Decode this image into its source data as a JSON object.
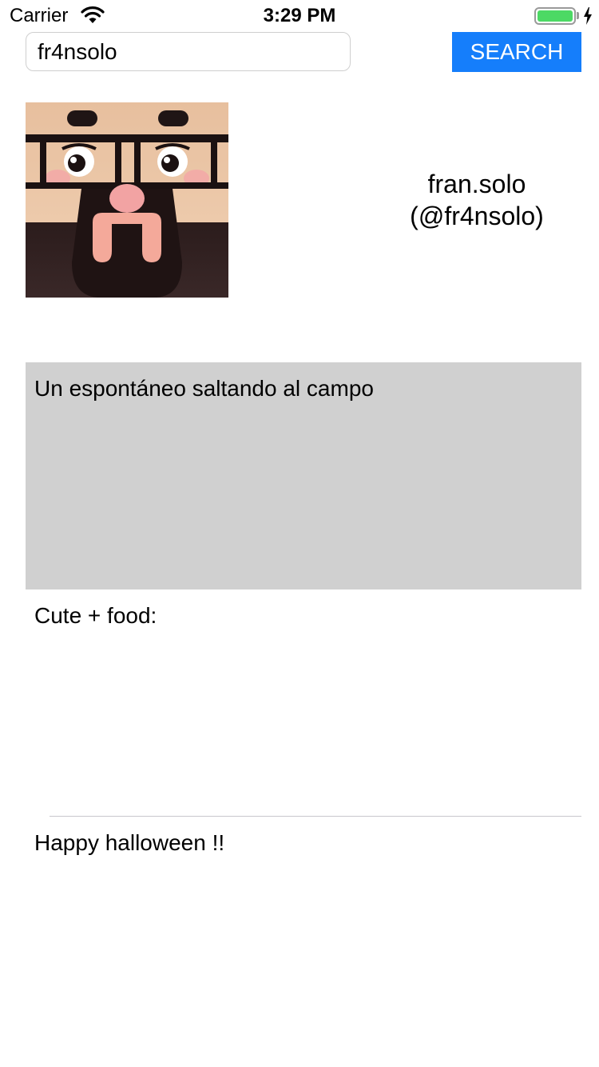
{
  "status_bar": {
    "carrier": "Carrier",
    "time": "3:29 PM",
    "battery_level": 1.0,
    "charging": true,
    "icons": [
      "wifi-icon",
      "battery-icon",
      "charging-bolt-icon"
    ]
  },
  "search": {
    "value": "fr4nsolo",
    "button_label": "SEARCH"
  },
  "profile": {
    "display_name": "fran.solo",
    "handle": "(@fr4nsolo)"
  },
  "feed": {
    "items": [
      {
        "text": "Un espontáneo saltando al campo",
        "selected": true
      },
      {
        "text": "Cute + food:",
        "selected": false
      },
      {
        "text": "Happy halloween !!",
        "selected": false
      }
    ]
  },
  "colors": {
    "accent": "#157efb",
    "battery": "#4cd964",
    "selected_row": "#d0d0d0",
    "separator": "#c8c7cc"
  }
}
